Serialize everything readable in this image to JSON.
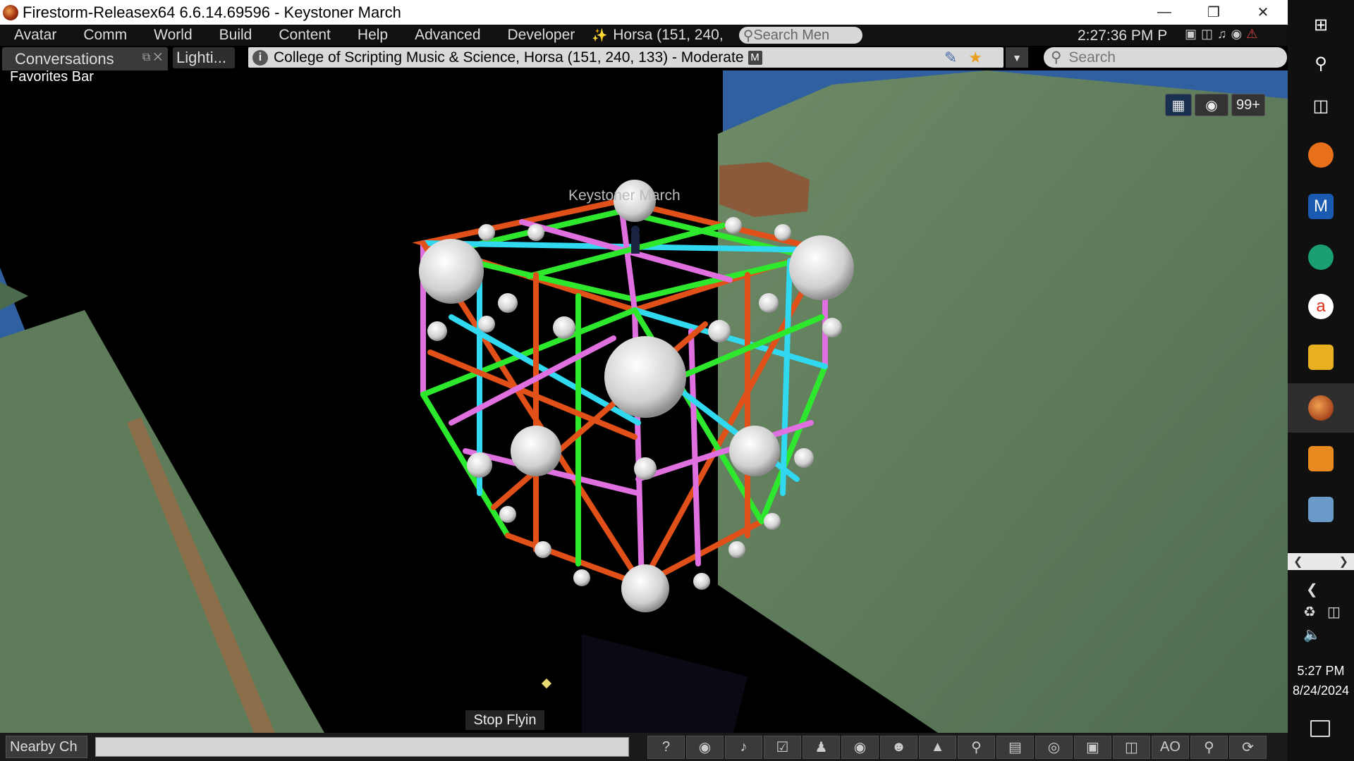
{
  "window": {
    "title": "Firestorm-Releasex64 6.6.14.69596 - Keystoner March"
  },
  "menu": {
    "items": [
      "Avatar",
      "Comm",
      "World",
      "Build",
      "Content",
      "Help",
      "Advanced",
      "Developer"
    ],
    "location": "Horsa (151, 240,",
    "search_placeholder": "Search Men",
    "clock": "2:27:36 PM P"
  },
  "tabs": {
    "conversations": "Conversations",
    "lighting": "Lighti..."
  },
  "location_bar": {
    "text": "College of Scripting Music & Science, Horsa (151, 240, 133) - Moderate",
    "maturity_badge": "M"
  },
  "search": {
    "placeholder": "Search"
  },
  "favorites_bar": "Favorites Bar",
  "scene": {
    "avatar_name": "Keystoner March",
    "stop_flying": "Stop Flyin"
  },
  "hud": {
    "badge_count": "99+"
  },
  "bottom": {
    "nearby_chat": "Nearby Ch",
    "toolbar_icons": [
      "help-icon",
      "speech-bubble-icon",
      "microphone-icon",
      "headphones-icon",
      "walk-icon",
      "eye-icon",
      "people-icon",
      "shirt-icon",
      "search-icon",
      "map-icon",
      "radar-icon",
      "camera-icon",
      "inventory-icon",
      "ao-text",
      "location-pin-icon",
      "refresh-icon"
    ],
    "ao_label": "AO"
  },
  "taskbar": {
    "time": "5:27 PM",
    "date": "8/24/2024",
    "apps": [
      "windows-logo",
      "search-icon",
      "task-view-icon",
      "firefox-icon",
      "m-app-icon",
      "edge-icon",
      "vlc-icon",
      "notes-icon",
      "firestorm-icon",
      "tool-icon",
      "remote-icon"
    ]
  },
  "colors": {
    "frame_green": "#2ee82e",
    "frame_magenta": "#e070e0",
    "frame_cyan": "#30d8f0",
    "frame_orange": "#e05018",
    "terrain": "#5a7a5a",
    "water": "#3060a0"
  }
}
